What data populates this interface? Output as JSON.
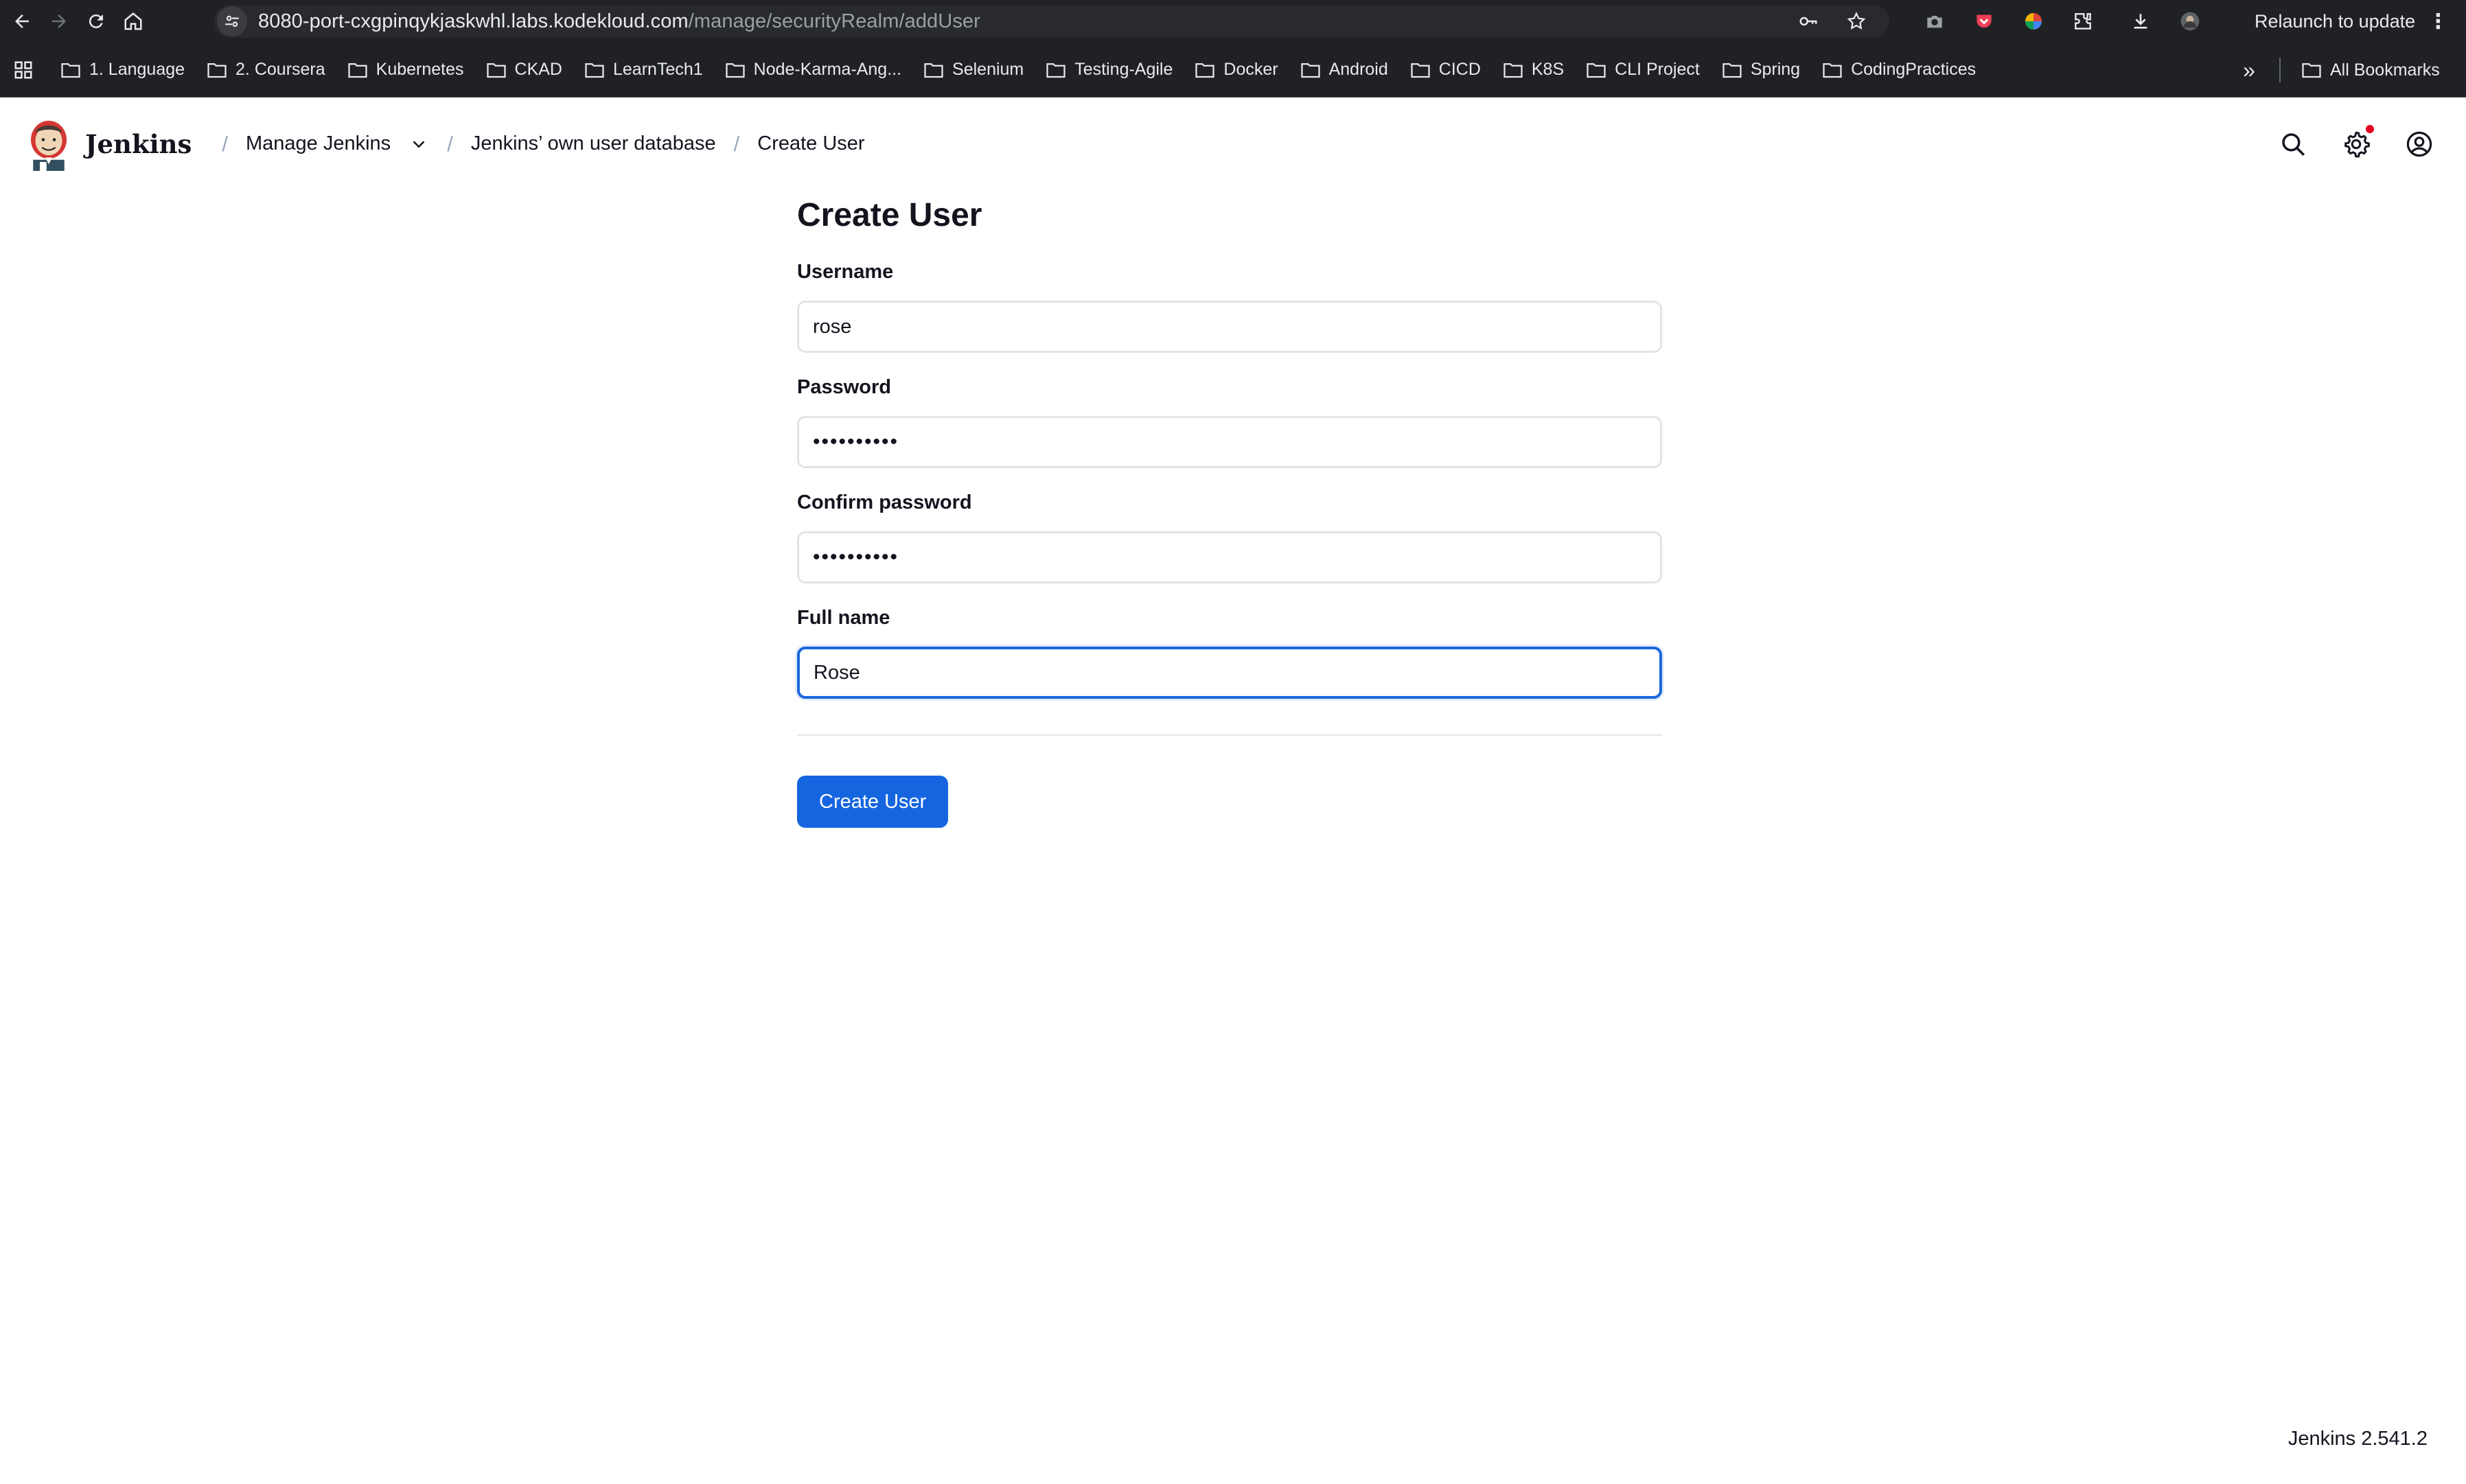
{
  "browser": {
    "url_host": "8080-port-cxgpinqykjaskwhl.labs.kodekloud.com",
    "url_path": "/manage/securityRealm/addUser",
    "relaunch_label": "Relaunch to update",
    "bookmarks": [
      "1. Language",
      "2. Coursera",
      "Kubernetes",
      "CKAD",
      "LearnTech1",
      "Node-Karma-Ang...",
      "Selenium",
      "Testing-Agile",
      "Docker",
      "Android",
      "CICD",
      "K8S",
      "CLI Project",
      "Spring",
      "CodingPractices"
    ],
    "all_bookmarks_label": "All Bookmarks"
  },
  "header": {
    "app_name": "Jenkins",
    "breadcrumbs": [
      "Manage Jenkins",
      "Jenkins’ own user database",
      "Create User"
    ]
  },
  "form": {
    "title": "Create User",
    "username_label": "Username",
    "username_value": "rose",
    "password_label": "Password",
    "password_masked": "••••••••••",
    "confirm_label": "Confirm password",
    "confirm_masked": "••••••••••",
    "fullname_label": "Full name",
    "fullname_value": "Rose",
    "submit_label": "Create User"
  },
  "footer": {
    "version": "Jenkins 2.541.2"
  },
  "colors": {
    "accent": "#1565e0",
    "focus_ring": "#1c68dc",
    "chrome_bg": "#202124"
  }
}
